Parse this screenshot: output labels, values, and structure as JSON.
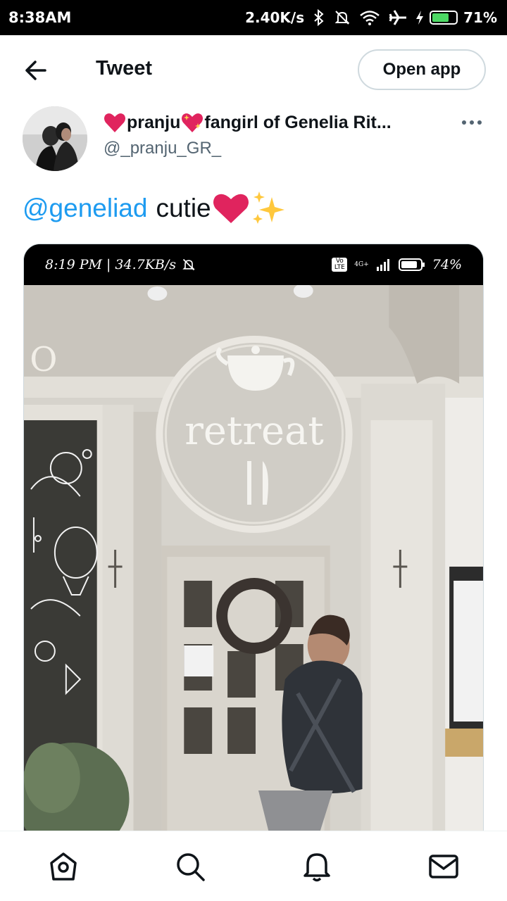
{
  "status_bar": {
    "time": "8:38AM",
    "net_speed": "2.40K/s",
    "battery": "71%",
    "icons": [
      "bluetooth-icon",
      "mute-icon",
      "wifi-icon",
      "airplane-icon",
      "charging-icon",
      "battery-icon"
    ]
  },
  "header": {
    "title": "Tweet",
    "open_app_label": "Open app"
  },
  "tweet": {
    "display_name_part1": "pranju",
    "display_name_part2": "fangirl of Genelia Rit...",
    "handle": "@_pranju_GR_",
    "mention": "@geneliad",
    "text": "cutie"
  },
  "media": {
    "inner_status_left": "8:19 PM | 34.7KB/s",
    "inner_status_battery": "74%",
    "network": "4G+",
    "volte": "Vo LTE",
    "sign_letter": "O",
    "sign_text": "retreat"
  },
  "nav": [
    "home-icon",
    "search-icon",
    "notifications-icon",
    "messages-icon"
  ],
  "colors": {
    "accent": "#1d9bf0",
    "heart": "#e0245e",
    "secondary_text": "#536471"
  }
}
